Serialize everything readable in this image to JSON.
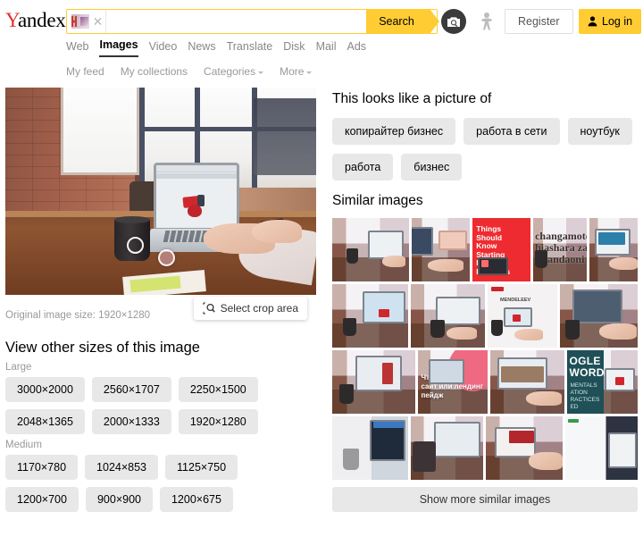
{
  "header": {
    "logo_y": "Y",
    "logo_rest": "andex",
    "search_value": "",
    "search_placeholder": "",
    "clear_icon": "close-icon",
    "thumbnail_icon": "search-image-thumbnail",
    "search_button": "Search",
    "camera_icon": "camera-search-icon",
    "accessibility_icon": "accessibility-person-icon",
    "register_button": "Register",
    "login_button": "Log in",
    "login_icon": "user-icon"
  },
  "tabs": [
    {
      "label": "Web",
      "active": false
    },
    {
      "label": "Images",
      "active": true
    },
    {
      "label": "Video",
      "active": false
    },
    {
      "label": "News",
      "active": false
    },
    {
      "label": "Translate",
      "active": false
    },
    {
      "label": "Disk",
      "active": false
    },
    {
      "label": "Mail",
      "active": false
    },
    {
      "label": "Ads",
      "active": false
    }
  ],
  "subnav": [
    {
      "label": "My feed",
      "caret": false
    },
    {
      "label": "My collections",
      "caret": false
    },
    {
      "label": "Categories",
      "caret": true
    },
    {
      "label": "More",
      "caret": true
    }
  ],
  "preview": {
    "alt": "office desk with laptop, mug and hands typing",
    "original_size_label": "Original image size: 1920×1280",
    "crop_button": "Select crop area",
    "crop_icon": "crop-area-icon",
    "hotspots": 2
  },
  "sizes": {
    "title": "View other sizes of this image",
    "groups": [
      {
        "label": "Large",
        "items": [
          "3000×2000",
          "2560×1707",
          "2250×1500",
          "2048×1365",
          "2000×1333",
          "1920×1280"
        ]
      },
      {
        "label": "Medium",
        "items": [
          "1170×780",
          "1024×853",
          "1125×750",
          "1200×700",
          "900×900",
          "1200×675"
        ]
      }
    ]
  },
  "looks_like": {
    "title": "This looks like a picture of",
    "tags": [
      "копирайтер бизнес",
      "работа в сети",
      "ноутбук",
      "работа",
      "бизнес"
    ]
  },
  "similar": {
    "title": "Similar images",
    "show_more_button": "Show more similar images",
    "overlays": {
      "red_caption": "Things\nShould\nKnow\nStarting\nInternet\nBusiness",
      "serif_caption": "changamoto\nbiashara za\nmtandaoni",
      "teal_title": "OGLE\nWORDS",
      "teal_sub": "MENTALS\nATION\nRACTICES\nED",
      "cyrillic_caption": "Что лучше:\nсайт или лендинг пейдж"
    }
  },
  "colors": {
    "brand_yellow": "#ffcc33",
    "logo_red": "#e03131",
    "chip_gray": "#e8e8e8",
    "muted_text": "#999999"
  }
}
